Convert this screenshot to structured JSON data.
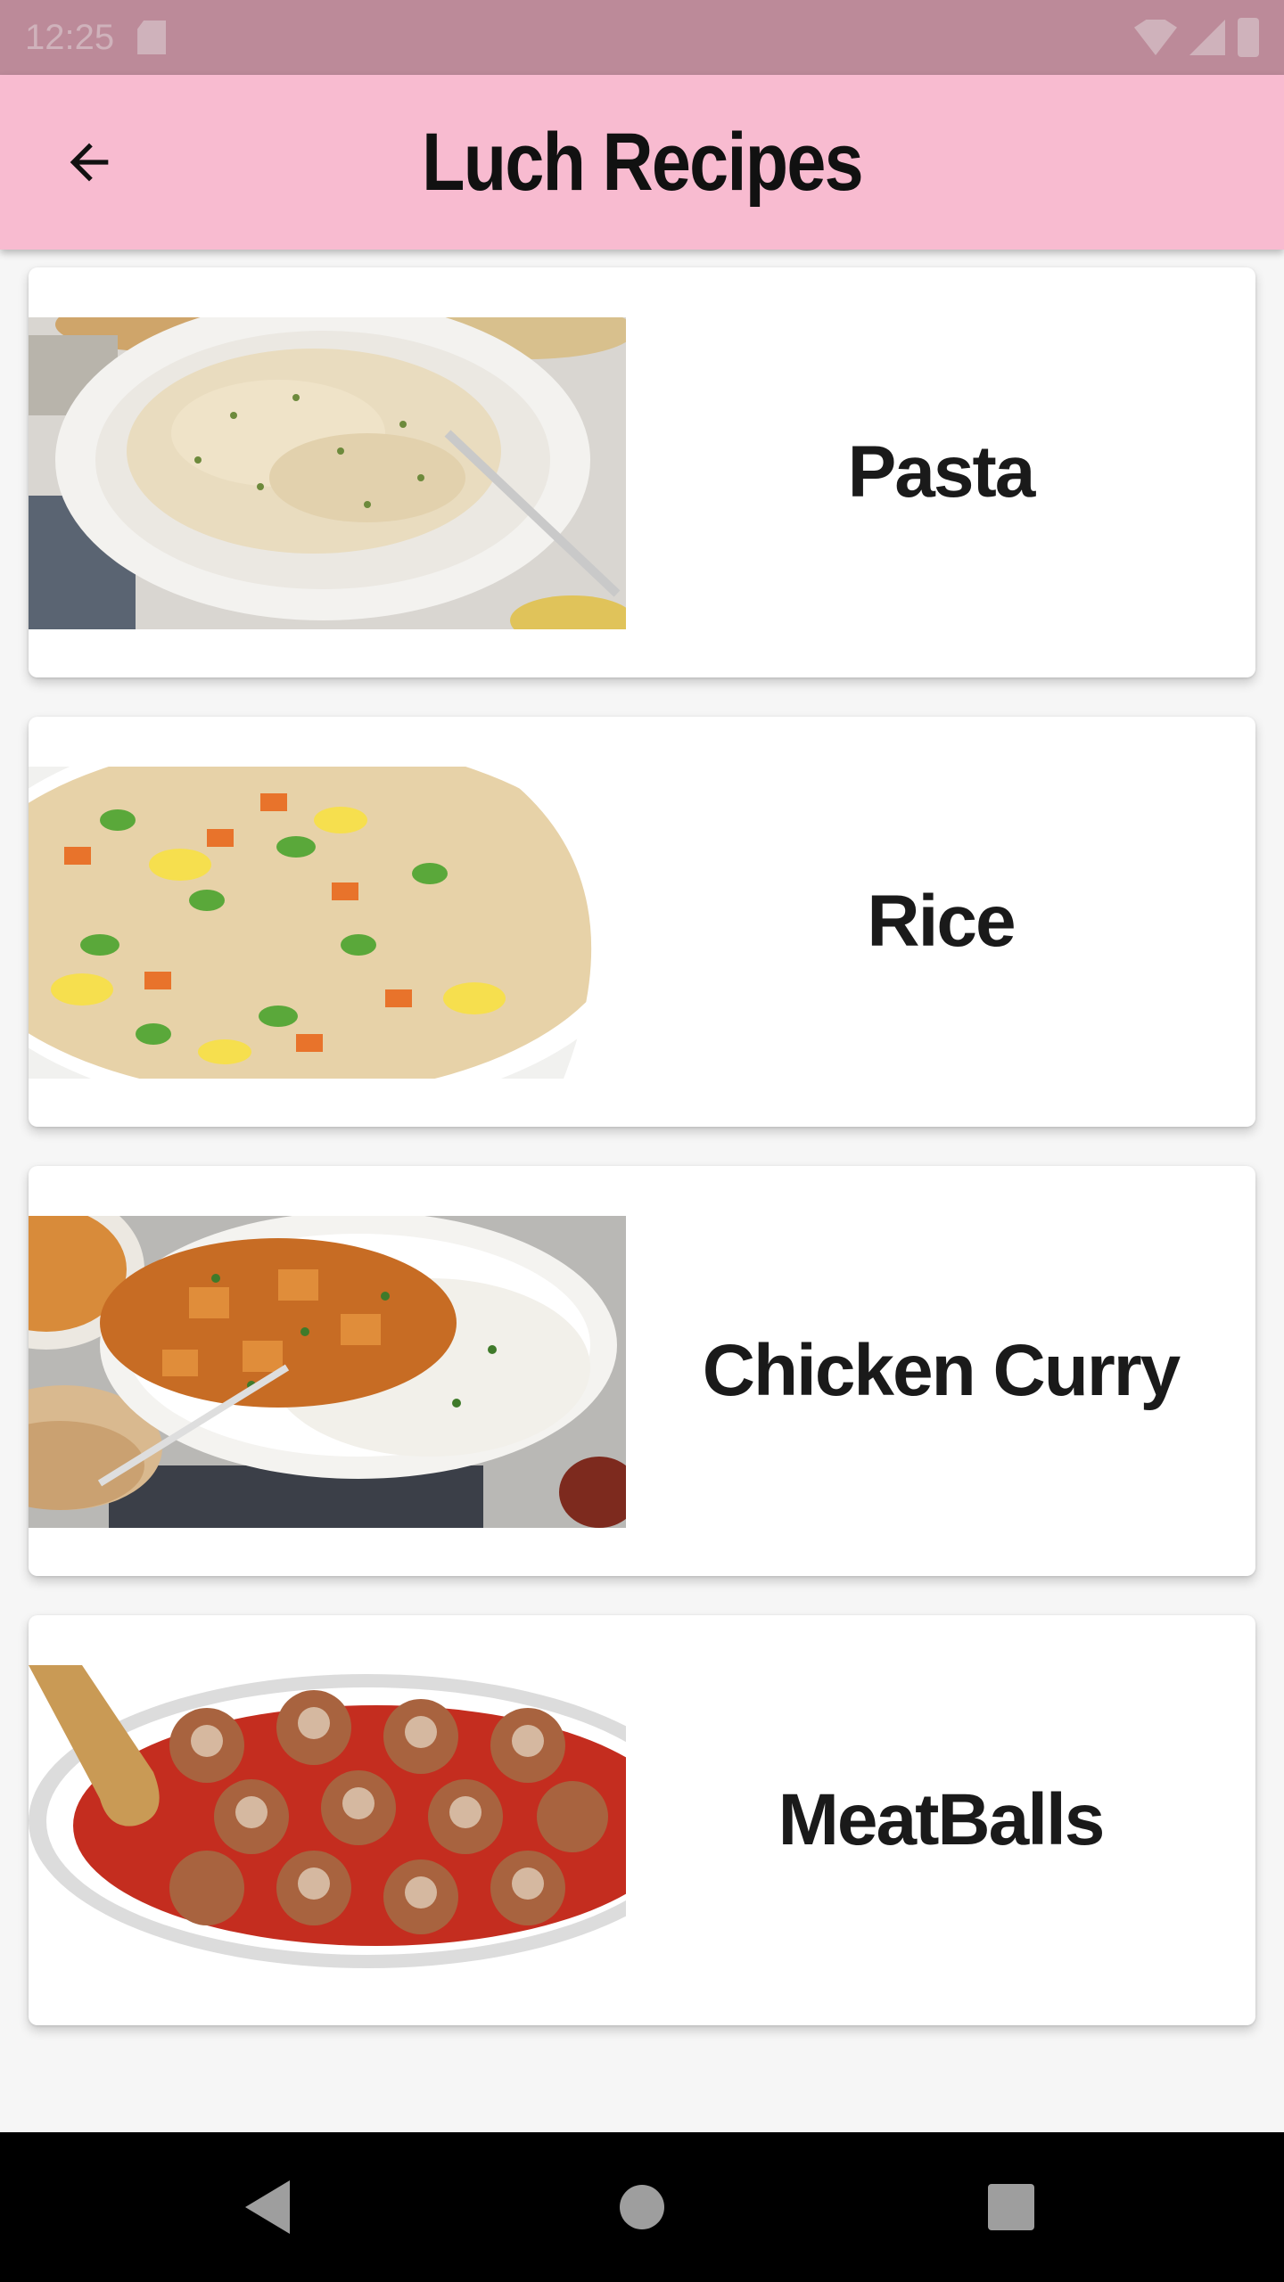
{
  "status_bar": {
    "time": "12:25",
    "icons": [
      "sd-card-icon",
      "wifi-icon",
      "signal-icon",
      "battery-icon"
    ]
  },
  "app_bar": {
    "title": "Luch Recipes",
    "back_icon": "arrow-back-icon",
    "background": "#f8bbd0"
  },
  "recipes": [
    {
      "label": "Pasta",
      "image": "pasta-fettuccine-photo"
    },
    {
      "label": "Rice",
      "image": "fried-rice-photo"
    },
    {
      "label": "Chicken Curry",
      "image": "chicken-curry-photo"
    },
    {
      "label": "MeatBalls",
      "image": "meatballs-photo"
    }
  ],
  "nav_bar": {
    "buttons": [
      "back-icon",
      "home-icon",
      "recents-icon"
    ]
  },
  "colors": {
    "status_bar": "#bc8a99",
    "app_bar": "#f8bbd0",
    "card": "#ffffff",
    "text": "#1a1a1a"
  }
}
